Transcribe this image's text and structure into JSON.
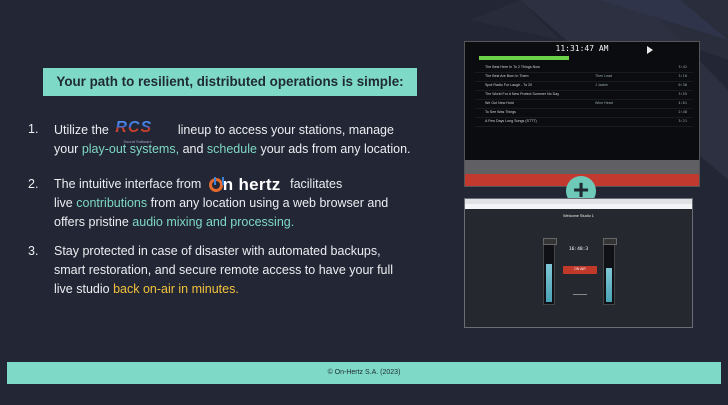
{
  "headline": "Your path to resilient, distributed operations is simple:",
  "points": [
    {
      "num": "1.",
      "t1": "Utilize the",
      "t2": "lineup to access your stations, manage",
      "t3": "your",
      "h1": "play-out systems,",
      "t4": "and",
      "h2": "schedule",
      "t5": "your ads from any location."
    },
    {
      "num": "2.",
      "t1": "The intuitive interface from",
      "t2": "facilitates",
      "t3": "live",
      "h1": "contributions",
      "t4": "from any location using a web browser and",
      "t5": "offers pristine",
      "h2": "audio mixing and processing."
    },
    {
      "num": "3.",
      "line1": "Stay protected in case of disaster with automated backups,",
      "line2": "smart restoration, and secure remote access to have your full",
      "t3": "live studio",
      "h1": "back on-air in minutes."
    }
  ],
  "logos": {
    "rcs": "RCS",
    "rcs_sub": "Sound Software",
    "onhertz": "n hertz"
  },
  "playout": {
    "clock": "11:31:47 AM",
    "rows": [
      {
        "title": "The Best Here In To 2 Things Now",
        "artist": "",
        "dur": "3:42"
      },
      {
        "title": "The Best Are Born In Them",
        "artist": "Then Lead",
        "dur": "3:10"
      },
      {
        "title": "Spot Radio For Laugh - To 20",
        "artist": "J Jackie",
        "dur": "0:30"
      },
      {
        "title": "The World For A New Protect Summer No Day",
        "artist": "",
        "dur": "3:55"
      },
      {
        "title": "We Out New Hold",
        "artist": "Wine Heart",
        "dur": "4:01"
      },
      {
        "title": "To See Was Things",
        "artist": "",
        "dur": "2:48"
      },
      {
        "title": "A Few Days Long Songs (STTT)",
        "artist": "",
        "dur": "3:21"
      }
    ]
  },
  "plus": "+",
  "studio": {
    "welcome": "Welcome Studio 1",
    "time": "16:48:3",
    "onair": "ON AIR"
  },
  "footer": "© On-Hertz S.A. (2023)",
  "colors": {
    "accent": "#7ed9c7",
    "background": "#232634",
    "band_colors": [
      "#5f5f64",
      "#c23a2f",
      "#d9b12f",
      "#3b7fd0",
      "#3f9b3a"
    ]
  }
}
